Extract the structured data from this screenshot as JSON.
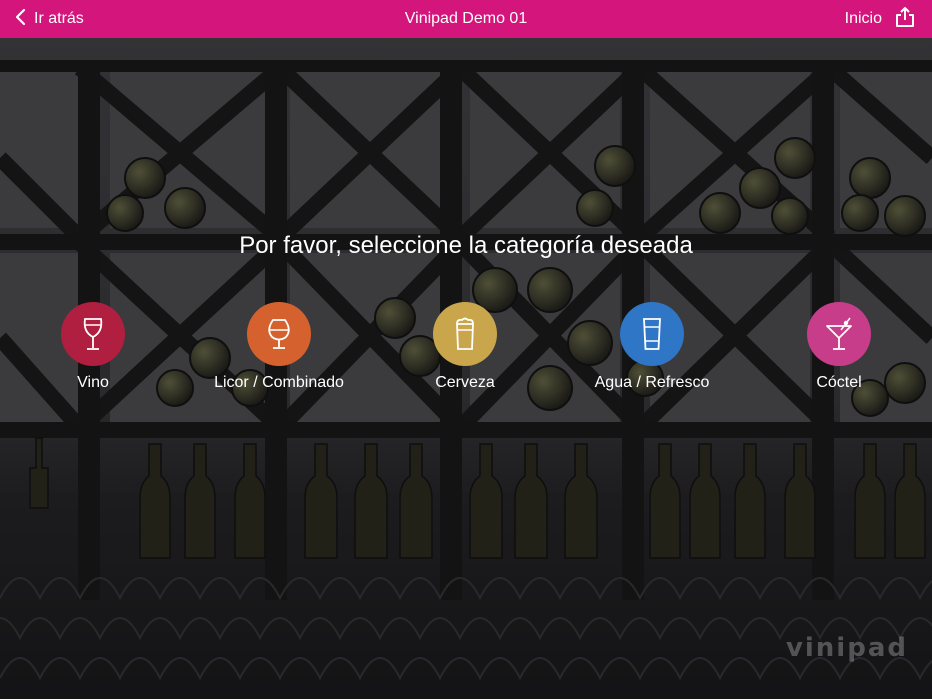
{
  "header": {
    "back_label": "Ir atrás",
    "title": "Vinipad Demo 01",
    "home_label": "Inicio"
  },
  "main": {
    "prompt": "Por favor, seleccione la categoría deseada",
    "categories": [
      {
        "label": "Vino",
        "icon": "wine-glass-icon",
        "color": "#b01e40"
      },
      {
        "label": "Licor / Combinado",
        "icon": "snifter-glass-icon",
        "color": "#d5622e"
      },
      {
        "label": "Cerveza",
        "icon": "beer-glass-icon",
        "color": "#c9a64c"
      },
      {
        "label": "Agua / Refresco",
        "icon": "water-glass-icon",
        "color": "#2f76c6"
      },
      {
        "label": "Cóctel",
        "icon": "cocktail-glass-icon",
        "color": "#c73d8a"
      }
    ]
  },
  "watermark": "vinipad",
  "colors": {
    "accent": "#d4157c"
  }
}
